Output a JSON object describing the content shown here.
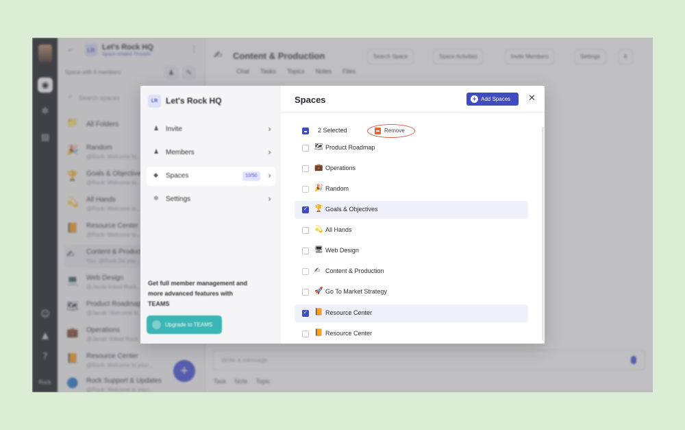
{
  "app": {
    "rail": {
      "label": "Rock",
      "icons": [
        "home-icon",
        "settings-icon",
        "docs-icon",
        "user-icon",
        "bell-icon",
        "help-icon"
      ]
    },
    "sidebar": {
      "workspace_initials": "LR",
      "workspace_name": "Let's Rock HQ",
      "workspace_sub": "Space-related Threads",
      "members_line": "Space with 6 members",
      "search_placeholder": "Search spaces",
      "items": [
        {
          "emoji": "📁",
          "name": "All Folders",
          "preview": ""
        },
        {
          "emoji": "🎉",
          "name": "Random",
          "preview": "@Rock: Welcome to..."
        },
        {
          "emoji": "🏆",
          "name": "Goals & Objectives",
          "preview": "@Rock: Welcome to..."
        },
        {
          "emoji": "💫",
          "name": "All Hands",
          "preview": "@Rock: Welcome to..."
        },
        {
          "emoji": "📙",
          "name": "Resource Center",
          "preview": "@Rock: Welcome to..."
        },
        {
          "emoji": "✍",
          "name": "Content & Production",
          "preview": "You: @Rock Do you..."
        },
        {
          "emoji": "💻",
          "name": "Web Design",
          "preview": "@Jacob linked Rock..."
        },
        {
          "emoji": "🗺",
          "name": "Product Roadmap",
          "preview": "@Jacob: Welcome to..."
        },
        {
          "emoji": "💼",
          "name": "Operations",
          "preview": "@Jacob: linked Rock..."
        },
        {
          "emoji": "📙",
          "name": "Resource Center",
          "preview": "@Rock: Welcome to your..."
        },
        {
          "emoji": "🔵",
          "name": "Rock Support & Updates",
          "preview": "@Rock: Welcome to your..."
        }
      ]
    },
    "main": {
      "channel_emoji": "✍",
      "channel_title": "Content & Production",
      "header_buttons": [
        "Search Space",
        "Space Activities",
        "Invite Members",
        "Settings",
        "6"
      ],
      "tabs": [
        "Chat",
        "Tasks",
        "Topics",
        "Notes",
        "Files"
      ],
      "composer_placeholder": "Write a message",
      "toolbar": [
        "Task",
        "Note",
        "Topic"
      ]
    }
  },
  "modal": {
    "left": {
      "initials": "LR",
      "title": "Let's Rock HQ",
      "nav": [
        {
          "icon": "person-add-icon",
          "label": "Invite"
        },
        {
          "icon": "members-icon",
          "label": "Members"
        },
        {
          "icon": "spaces-icon",
          "label": "Spaces",
          "badge": "10/50",
          "active": true
        },
        {
          "icon": "gear-icon",
          "label": "Settings"
        }
      ],
      "promo": "Get full member management and more advanced features with TEAMS",
      "upgrade_label": "Upgrade to TEAMS"
    },
    "right": {
      "title": "Spaces",
      "add_button": "Add Spaces",
      "selected_label": "2 Selected",
      "remove_label": "Remove",
      "spaces": [
        {
          "emoji": "🗺",
          "name": "Product Roadmap",
          "checked": false
        },
        {
          "emoji": "💼",
          "name": "Operations",
          "checked": false
        },
        {
          "emoji": "🎉",
          "name": "Random",
          "checked": false
        },
        {
          "emoji": "🏆",
          "name": "Goals & Objectives",
          "checked": true
        },
        {
          "emoji": "💫",
          "name": "All Hands",
          "checked": false
        },
        {
          "emoji": "🖥",
          "name": "Web Design",
          "checked": false
        },
        {
          "emoji": "✍",
          "name": "Content & Production",
          "checked": false
        },
        {
          "emoji": "🚀",
          "name": "Go To Market Strategy",
          "checked": false
        },
        {
          "emoji": "📙",
          "name": "Resource Center",
          "checked": true
        },
        {
          "emoji": "📙",
          "name": "Resource Center",
          "checked": false
        }
      ]
    }
  },
  "colors": {
    "accent": "#3f4bbf",
    "remove_highlight": "#d9594a",
    "teal": "#3bb5b5",
    "background": "#dbeed5"
  }
}
